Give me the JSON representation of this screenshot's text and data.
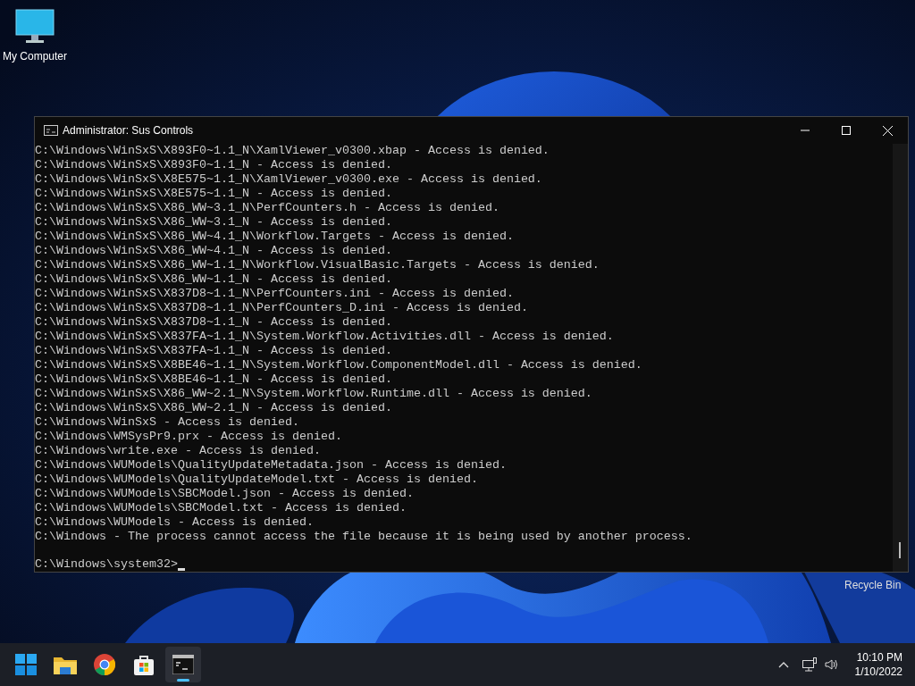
{
  "desktop_icons": [
    {
      "label": "My Computer"
    }
  ],
  "console_window": {
    "title": "Administrator: Sus Controls",
    "lines": [
      "C:\\Windows\\WinSxS\\X893F0~1.1_N\\XamlViewer_v0300.xbap - Access is denied.",
      "C:\\Windows\\WinSxS\\X893F0~1.1_N - Access is denied.",
      "C:\\Windows\\WinSxS\\X8E575~1.1_N\\XamlViewer_v0300.exe - Access is denied.",
      "C:\\Windows\\WinSxS\\X8E575~1.1_N - Access is denied.",
      "C:\\Windows\\WinSxS\\X86_WW~3.1_N\\PerfCounters.h - Access is denied.",
      "C:\\Windows\\WinSxS\\X86_WW~3.1_N - Access is denied.",
      "C:\\Windows\\WinSxS\\X86_WW~4.1_N\\Workflow.Targets - Access is denied.",
      "C:\\Windows\\WinSxS\\X86_WW~4.1_N - Access is denied.",
      "C:\\Windows\\WinSxS\\X86_WW~1.1_N\\Workflow.VisualBasic.Targets - Access is denied.",
      "C:\\Windows\\WinSxS\\X86_WW~1.1_N - Access is denied.",
      "C:\\Windows\\WinSxS\\X837D8~1.1_N\\PerfCounters.ini - Access is denied.",
      "C:\\Windows\\WinSxS\\X837D8~1.1_N\\PerfCounters_D.ini - Access is denied.",
      "C:\\Windows\\WinSxS\\X837D8~1.1_N - Access is denied.",
      "C:\\Windows\\WinSxS\\X837FA~1.1_N\\System.Workflow.Activities.dll - Access is denied.",
      "C:\\Windows\\WinSxS\\X837FA~1.1_N - Access is denied.",
      "C:\\Windows\\WinSxS\\X8BE46~1.1_N\\System.Workflow.ComponentModel.dll - Access is denied.",
      "C:\\Windows\\WinSxS\\X8BE46~1.1_N - Access is denied.",
      "C:\\Windows\\WinSxS\\X86_WW~2.1_N\\System.Workflow.Runtime.dll - Access is denied.",
      "C:\\Windows\\WinSxS\\X86_WW~2.1_N - Access is denied.",
      "C:\\Windows\\WinSxS - Access is denied.",
      "C:\\Windows\\WMSysPr9.prx - Access is denied.",
      "C:\\Windows\\write.exe - Access is denied.",
      "C:\\Windows\\WUModels\\QualityUpdateMetadata.json - Access is denied.",
      "C:\\Windows\\WUModels\\QualityUpdateModel.txt - Access is denied.",
      "C:\\Windows\\WUModels\\SBCModel.json - Access is denied.",
      "C:\\Windows\\WUModels\\SBCModel.txt - Access is denied.",
      "C:\\Windows\\WUModels - Access is denied.",
      "C:\\Windows - The process cannot access the file because it is being used by another process."
    ],
    "prompt": "C:\\Windows\\system32>"
  },
  "recycle_bin": {
    "label": "Recycle Bin"
  },
  "taskbar": {
    "apps": [
      {
        "kind": "start",
        "selected": false
      },
      {
        "kind": "folder",
        "selected": false
      },
      {
        "kind": "browser",
        "selected": false
      },
      {
        "kind": "store",
        "selected": false
      },
      {
        "kind": "terminal",
        "selected": true
      }
    ],
    "clock": {
      "time": "10:10 PM",
      "date": "1/10/2022"
    }
  }
}
